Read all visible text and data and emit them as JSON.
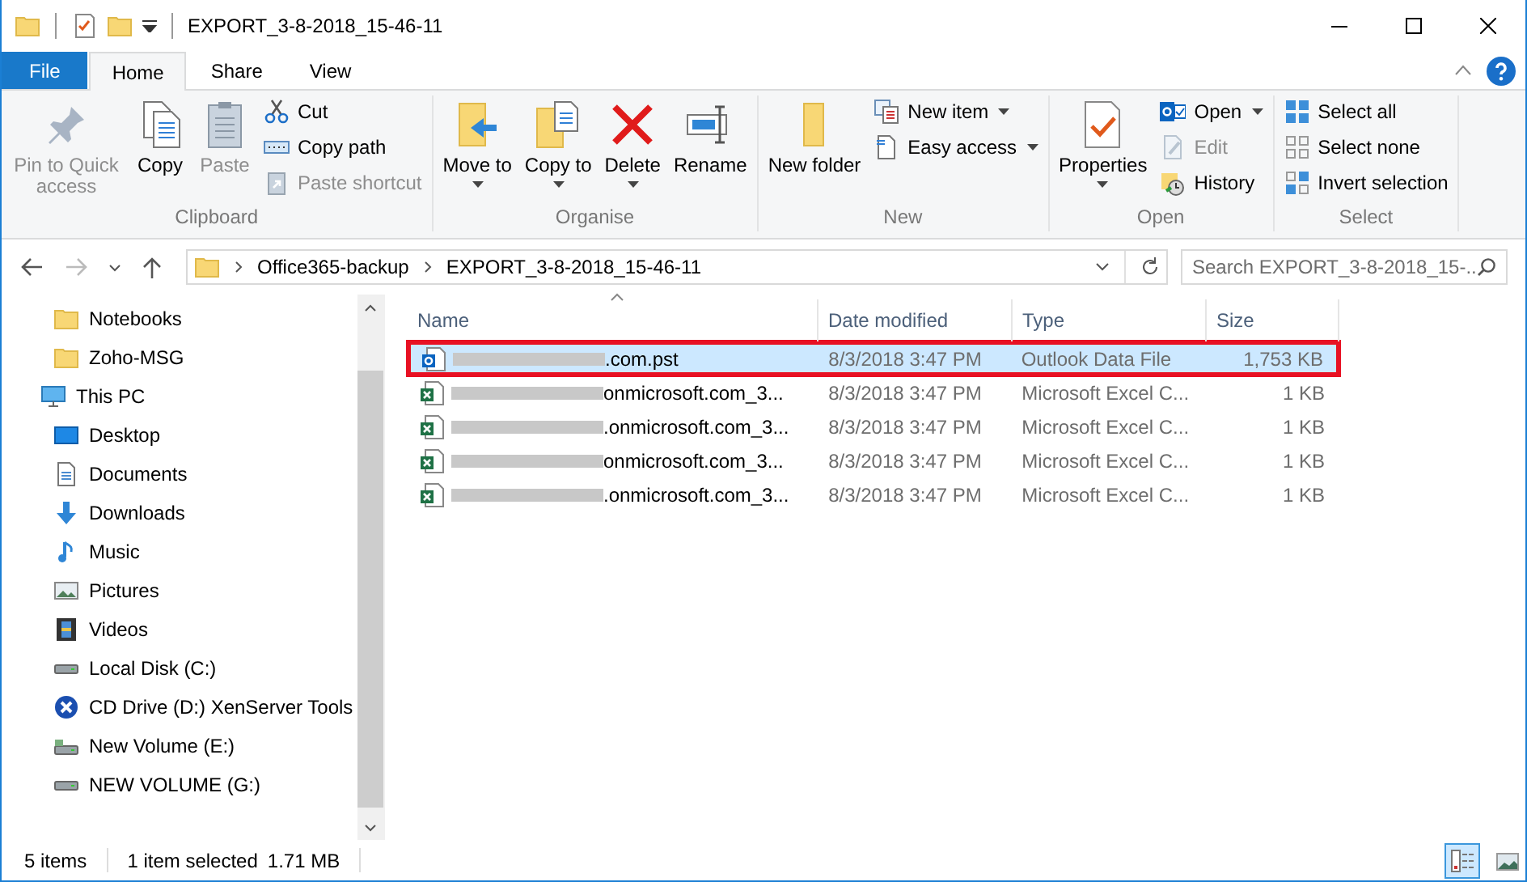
{
  "window": {
    "title": "EXPORT_3-8-2018_15-46-11"
  },
  "tabs": [
    {
      "label": "File",
      "kind": "file",
      "selected": false
    },
    {
      "label": "Home",
      "kind": "tab",
      "selected": true
    },
    {
      "label": "Share",
      "kind": "tab",
      "selected": false
    },
    {
      "label": "View",
      "kind": "tab",
      "selected": false
    }
  ],
  "ribbon": {
    "groups": [
      {
        "label": "Clipboard",
        "items": [
          {
            "kind": "large",
            "label": "Pin to Quick access",
            "disabled": true,
            "dropdown": false
          },
          {
            "kind": "large",
            "label": "Copy",
            "disabled": false,
            "dropdown": false
          },
          {
            "kind": "large",
            "label": "Paste",
            "disabled": true,
            "dropdown": false
          },
          {
            "kind": "small",
            "label": "Cut",
            "disabled": false,
            "dropdown": false
          },
          {
            "kind": "small",
            "label": "Copy path",
            "disabled": false,
            "dropdown": false
          },
          {
            "kind": "small",
            "label": "Paste shortcut",
            "disabled": true,
            "dropdown": false
          }
        ]
      },
      {
        "label": "Organise",
        "items": [
          {
            "kind": "large",
            "label": "Move to",
            "disabled": false,
            "dropdown": true
          },
          {
            "kind": "large",
            "label": "Copy to",
            "disabled": false,
            "dropdown": true
          },
          {
            "kind": "large",
            "label": "Delete",
            "disabled": false,
            "dropdown": true
          },
          {
            "kind": "large",
            "label": "Rename",
            "disabled": false,
            "dropdown": false
          }
        ]
      },
      {
        "label": "New",
        "items": [
          {
            "kind": "large",
            "label": "New folder",
            "disabled": false,
            "dropdown": false
          },
          {
            "kind": "small",
            "label": "New item",
            "disabled": false,
            "dropdown": true
          },
          {
            "kind": "small",
            "label": "Easy access",
            "disabled": false,
            "dropdown": true
          }
        ]
      },
      {
        "label": "Open",
        "items": [
          {
            "kind": "large",
            "label": "Properties",
            "disabled": false,
            "dropdown": true
          },
          {
            "kind": "small",
            "label": "Open",
            "disabled": false,
            "dropdown": true
          },
          {
            "kind": "small",
            "label": "Edit",
            "disabled": true,
            "dropdown": false
          },
          {
            "kind": "small",
            "label": "History",
            "disabled": false,
            "dropdown": false
          }
        ]
      },
      {
        "label": "Select",
        "items": [
          {
            "kind": "small",
            "label": "Select all",
            "disabled": false,
            "dropdown": false
          },
          {
            "kind": "small",
            "label": "Select none",
            "disabled": false,
            "dropdown": false
          },
          {
            "kind": "small",
            "label": "Invert selection",
            "disabled": false,
            "dropdown": false
          }
        ]
      }
    ]
  },
  "address": {
    "path": [
      "Office365-backup",
      "EXPORT_3-8-2018_15-46-11"
    ],
    "search": {
      "placeholder": "Search EXPORT_3-8-2018_15-..."
    }
  },
  "sidebar": {
    "items": [
      {
        "label": "Notebooks",
        "kind": "folder"
      },
      {
        "label": "Zoho-MSG",
        "kind": "folder"
      },
      {
        "label": "This PC",
        "kind": "pc",
        "children": [
          {
            "label": "Desktop",
            "kind": "desktop"
          },
          {
            "label": "Documents",
            "kind": "documents"
          },
          {
            "label": "Downloads",
            "kind": "downloads"
          },
          {
            "label": "Music",
            "kind": "music"
          },
          {
            "label": "Pictures",
            "kind": "pictures"
          },
          {
            "label": "Videos",
            "kind": "videos"
          },
          {
            "label": "Local Disk (C:)",
            "kind": "disk"
          },
          {
            "label": "CD Drive (D:) XenServer Tools",
            "kind": "cd"
          },
          {
            "label": "New Volume (E:)",
            "kind": "volume"
          },
          {
            "label": "NEW VOLUME (G:)",
            "kind": "disk"
          }
        ]
      }
    ]
  },
  "table": {
    "columns": [
      "Name",
      "Date modified",
      "Type",
      "Size"
    ],
    "rows": [
      {
        "kind": "outlook",
        "name": ".com.pst",
        "date": "8/3/2018 3:47 PM",
        "type": "Outlook Data File",
        "size": "1,753 KB",
        "selected": true,
        "highlighted": true
      },
      {
        "kind": "excel",
        "name": "onmicrosoft.com_3...",
        "date": "8/3/2018 3:47 PM",
        "type": "Microsoft Excel C...",
        "size": "1 KB",
        "selected": false,
        "highlighted": false
      },
      {
        "kind": "excel",
        "name": ".onmicrosoft.com_3...",
        "date": "8/3/2018 3:47 PM",
        "type": "Microsoft Excel C...",
        "size": "1 KB",
        "selected": false,
        "highlighted": false
      },
      {
        "kind": "excel",
        "name": "onmicrosoft.com_3...",
        "date": "8/3/2018 3:47 PM",
        "type": "Microsoft Excel C...",
        "size": "1 KB",
        "selected": false,
        "highlighted": false
      },
      {
        "kind": "excel",
        "name": ".onmicrosoft.com_3...",
        "date": "8/3/2018 3:47 PM",
        "type": "Microsoft Excel C...",
        "size": "1 KB",
        "selected": false,
        "highlighted": false
      }
    ]
  },
  "status_bar": {
    "count": "5 items",
    "selection": "1 item selected",
    "size": "1.71 MB",
    "views": [
      {
        "kind": "details",
        "selected": true
      },
      {
        "kind": "large-icons",
        "selected": false
      }
    ]
  }
}
